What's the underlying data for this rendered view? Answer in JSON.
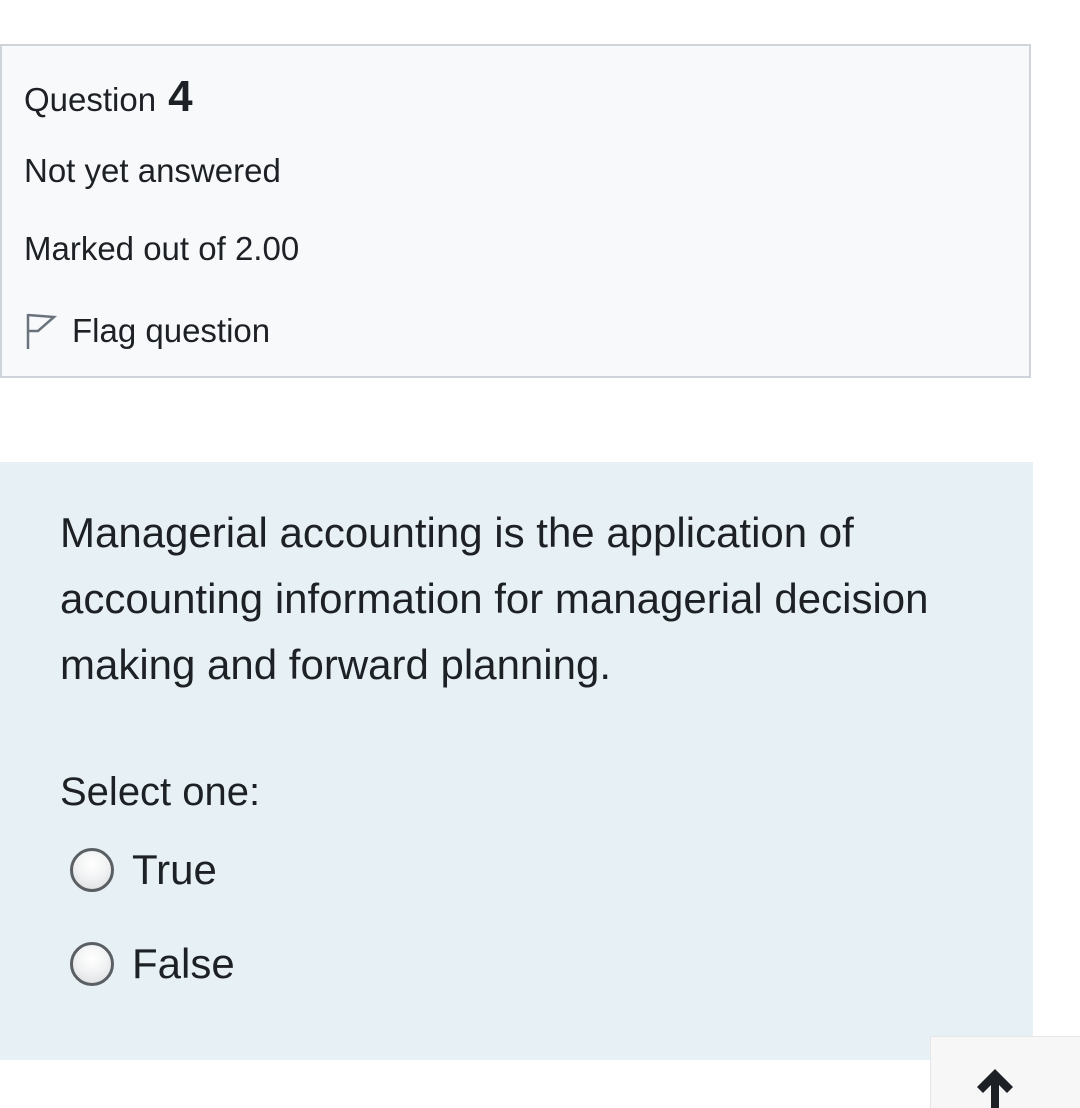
{
  "question_info": {
    "label": "Question",
    "number": "4",
    "state": "Not yet answered",
    "grade": "Marked out of 2.00",
    "flag_label": "Flag question",
    "flag_icon": "flag-outline-icon"
  },
  "question": {
    "text": "Managerial accounting is the application of accounting information for managerial decision making and forward planning.",
    "prompt": "Select one:",
    "options": [
      {
        "label": "True",
        "selected": false
      },
      {
        "label": "False",
        "selected": false
      }
    ]
  },
  "scroll_top": {
    "icon": "arrow-up-icon"
  },
  "colors": {
    "info_background": "#f7f9fa",
    "info_border": "#ced4da",
    "content_background": "#e7f1f5",
    "text": "#1d2125"
  }
}
